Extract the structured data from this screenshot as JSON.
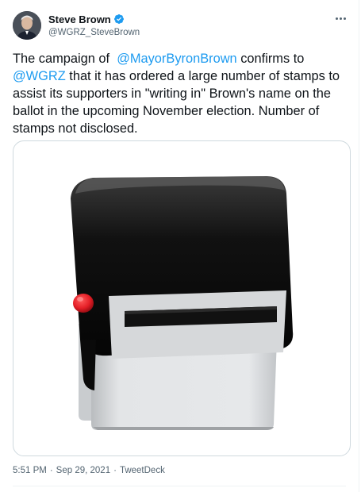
{
  "author": {
    "display_name": "Steve Brown",
    "handle": "@WGRZ_SteveBrown",
    "verified": true
  },
  "tweet": {
    "text_part1": "The campaign of  ",
    "mention1": "@MayorByronBrown",
    "text_part2": " confirms to ",
    "mention2": "@WGRZ",
    "text_part3": " that it has ordered a large number of stamps to assist its supporters in \"writing in\" Brown's name on the ballot in the upcoming November election. Number of stamps not disclosed."
  },
  "meta": {
    "time": "5:51 PM",
    "separator": "·",
    "date": "Sep 29, 2021",
    "source": "TweetDeck"
  },
  "colors": {
    "link": "#1d9bf0",
    "verified": "#1d9bf0",
    "stamp_button": "#e41e26"
  },
  "icons": {
    "verified": "verified-badge-icon",
    "more": "more-options-icon"
  }
}
